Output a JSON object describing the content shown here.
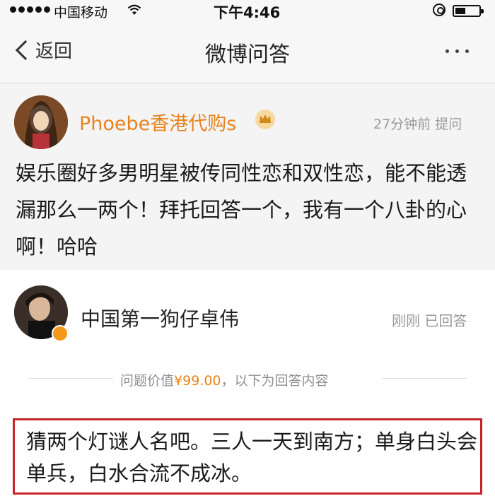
{
  "status_bar": {
    "carrier": "中国移动",
    "time": "下午4:46"
  },
  "nav": {
    "back_label": "返回",
    "title": "微博问答"
  },
  "question": {
    "asker_name": "Phoebe香港代购s",
    "meta": "27分钟前 提问",
    "text": "娱乐圈好多男明星被传同性恋和双性恋，能不能透漏那么一两个！拜托回答一个，我有一个八卦的心啊！哈哈"
  },
  "answer": {
    "answerer_name": "中国第一狗仔卓伟",
    "meta": "刚刚 已回答",
    "value_prefix": "问题价值",
    "value_price": "¥99.00",
    "value_suffix": "，以下为回答内容",
    "text": "猜两个灯谜人名吧。三人一天到南方；单身白头会单兵，白水合流不成冰。"
  },
  "colors": {
    "accent_orange": "#e8841f",
    "highlight_red": "#c8232c"
  },
  "icons": [
    "signal-icon",
    "wifi-icon",
    "lock-rotation-icon",
    "battery-icon",
    "back-chevron-icon",
    "more-icon",
    "vip-crown-icon",
    "verified-badge-icon"
  ]
}
